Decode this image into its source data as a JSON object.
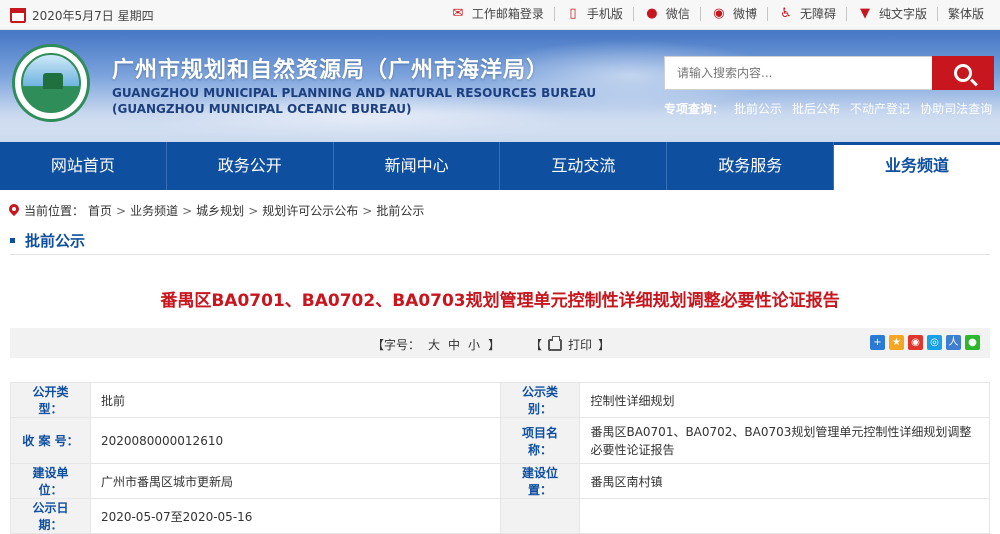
{
  "topbar": {
    "date": "2020年5月7日 星期四",
    "links": [
      {
        "label": "工作邮箱登录",
        "icon": "mail-icon"
      },
      {
        "label": "手机版",
        "icon": "mobile-icon"
      },
      {
        "label": "微信",
        "icon": "wechat-icon"
      },
      {
        "label": "微博",
        "icon": "weibo-icon"
      },
      {
        "label": "无障碍",
        "icon": "accessibility-icon"
      },
      {
        "label": "纯文字版",
        "icon": "shirt-icon"
      },
      {
        "label": "繁体版",
        "icon": ""
      }
    ]
  },
  "header": {
    "title_cn": "广州市规划和自然资源局（广州市海洋局）",
    "title_en_1": "GUANGZHOU MUNICIPAL PLANNING AND NATURAL RESOURCES BUREAU",
    "title_en_2": "(GUANGZHOU MUNICIPAL OCEANIC BUREAU)",
    "search_placeholder": "请输入搜索内容...",
    "quick_label": "专项查询：",
    "quick_links": [
      "批前公示",
      "批后公布",
      "不动产登记",
      "协助司法查询"
    ]
  },
  "nav": {
    "items": [
      "网站首页",
      "政务公开",
      "新闻中心",
      "互动交流",
      "政务服务",
      "业务频道"
    ],
    "active": "业务频道"
  },
  "breadcrumb": {
    "label": "当前位置：",
    "items": [
      "首页",
      "业务频道",
      "城乡规划",
      "规划许可公示公布",
      "批前公示"
    ]
  },
  "section_title": "批前公示",
  "article": {
    "title": "番禺区BA0701、BA0702、BA0703规划管理单元控制性详细规划调整必要性论证报告"
  },
  "tools": {
    "font_label": "【字号：",
    "font_sizes": [
      "大",
      "中",
      "小"
    ],
    "font_close": "】",
    "print_open": "【",
    "print_label": "打印",
    "print_close": "】"
  },
  "info": {
    "rows": [
      {
        "l1": "公开类型：",
        "v1": "批前",
        "l2": "公示类别：",
        "v2": "控制性详细规划"
      },
      {
        "l1": "收 案 号：",
        "v1": "2020080000012610",
        "l2": "项目名称：",
        "v2": "番禺区BA0701、BA0702、BA0703规划管理单元控制性详细规划调整必要性论证报告"
      },
      {
        "l1": "建设单位：",
        "v1": "广州市番禺区城市更新局",
        "l2": "建设位置：",
        "v2": "番禺区南村镇"
      },
      {
        "l1": "公示日期：",
        "v1": "2020-05-07至2020-05-16",
        "l2": "",
        "v2": ""
      }
    ]
  },
  "colors": {
    "brand_red": "#c7161d",
    "nav_blue": "#0f4fa0"
  }
}
